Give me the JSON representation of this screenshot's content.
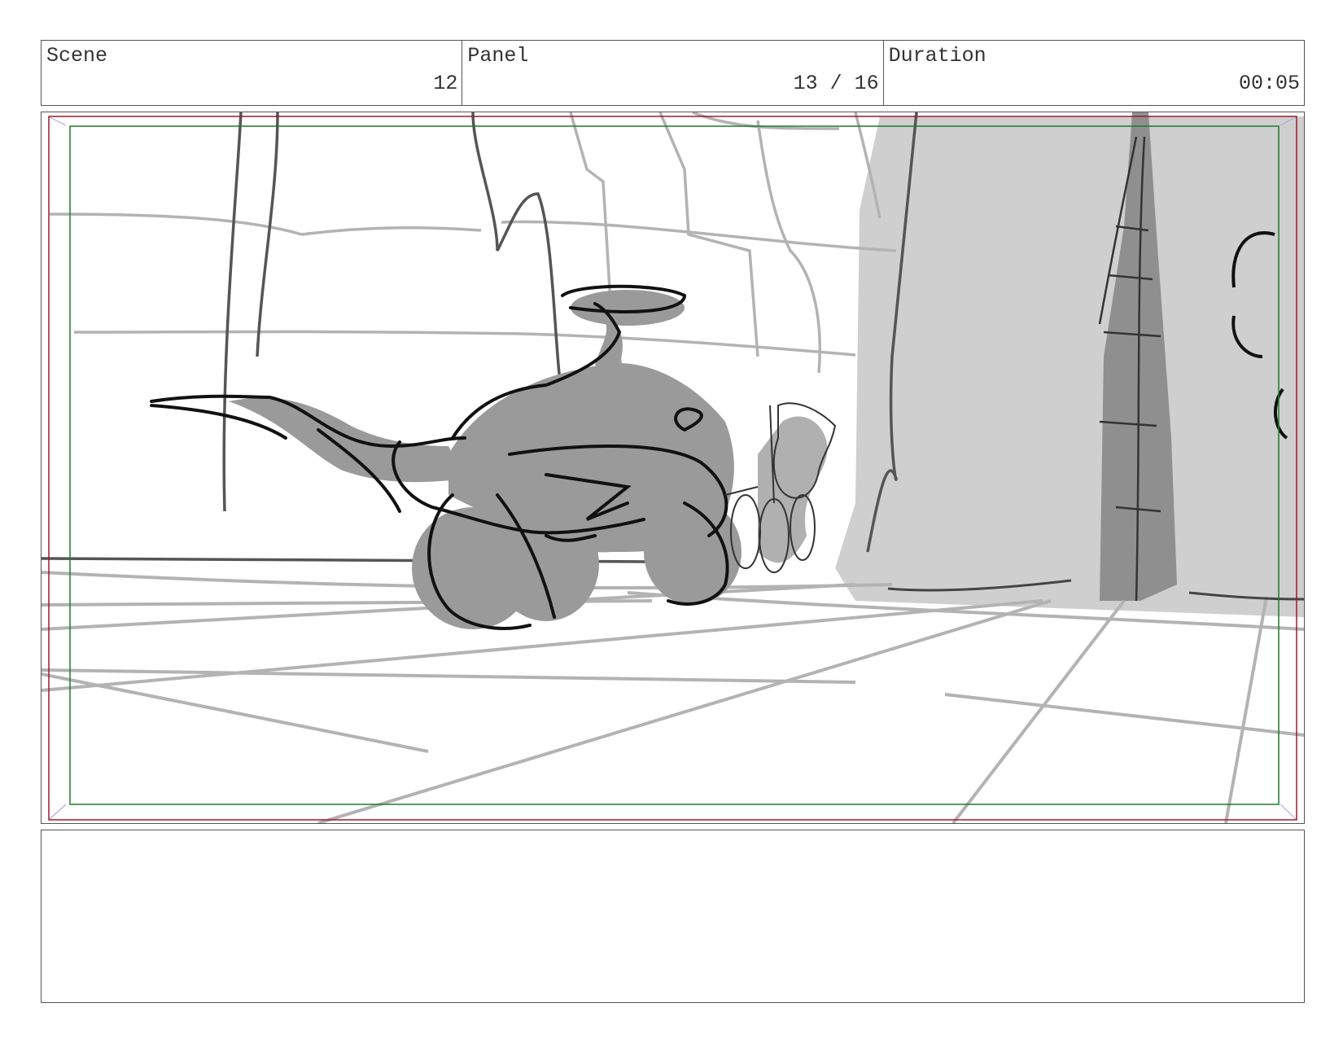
{
  "header": {
    "scene_label": "Scene",
    "scene_value": "12",
    "panel_label": "Panel",
    "panel_value": "13 / 16",
    "duration_label": "Duration",
    "duration_value": "00:05"
  },
  "frame": {
    "safe_area_outer_color": "#9b1b30",
    "safe_area_inner_color": "#1f7a2a"
  },
  "notes": {
    "text": ""
  }
}
